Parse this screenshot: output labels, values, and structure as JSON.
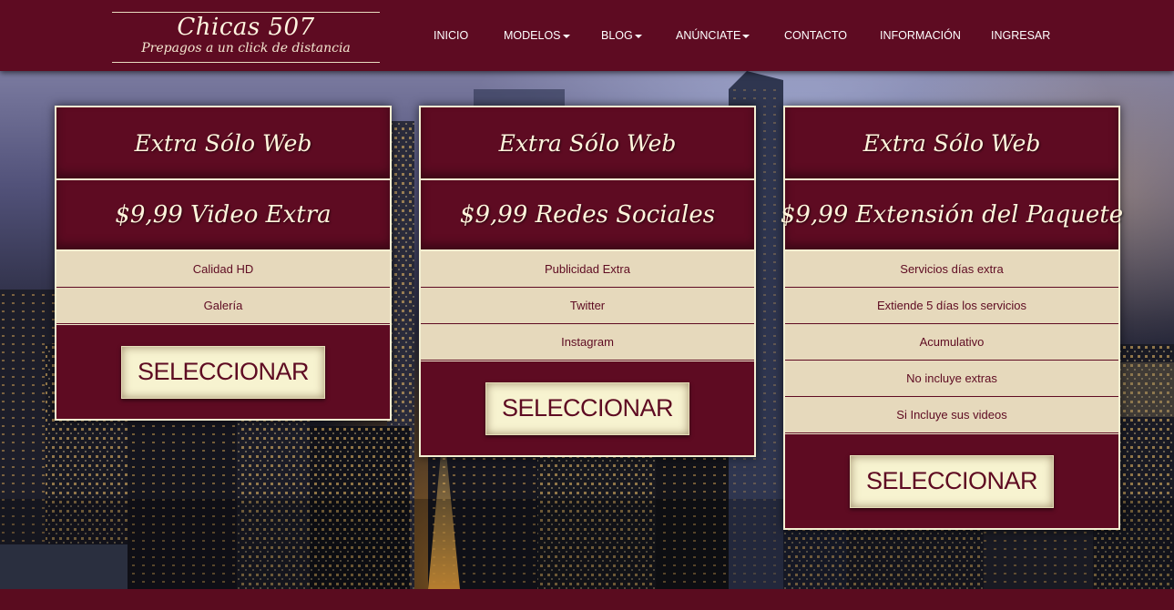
{
  "brand": {
    "title": "Chicas 507",
    "tagline": "Prepagos a un click de distancia"
  },
  "nav": {
    "items": [
      {
        "label": "INICIO",
        "dropdown": false
      },
      {
        "label": "MODELOS",
        "dropdown": true
      },
      {
        "label": "BLOG",
        "dropdown": true
      },
      {
        "label": "ANÚNCIATE",
        "dropdown": true
      },
      {
        "label": "CONTACTO",
        "dropdown": false
      },
      {
        "label": "INFORMACIÓN",
        "dropdown": false
      },
      {
        "label": "INGRESAR",
        "dropdown": false
      }
    ]
  },
  "cards": [
    {
      "heading": "Extra Sólo Web",
      "price": "$9,99 Video Extra",
      "features": [
        "Calidad HD",
        "Galería"
      ],
      "button": "SELECCIONAR"
    },
    {
      "heading": "Extra Sólo Web",
      "price": "$9,99 Redes Sociales",
      "features": [
        "Publicidad Extra",
        "Twitter",
        "Instagram"
      ],
      "button": "SELECCIONAR"
    },
    {
      "heading": "Extra Sólo Web",
      "price": "$9,99 Extensión del Paquete",
      "features": [
        "Servicios días extra",
        "Extiende 5 días los servicios",
        "Acumulativo",
        "No incluye extras",
        "Si Incluye sus videos"
      ],
      "button": "SELECCIONAR"
    }
  ],
  "colors": {
    "primary": "#5e0b22",
    "cream": "#f7f3d0",
    "text_light": "#fff5dc"
  }
}
